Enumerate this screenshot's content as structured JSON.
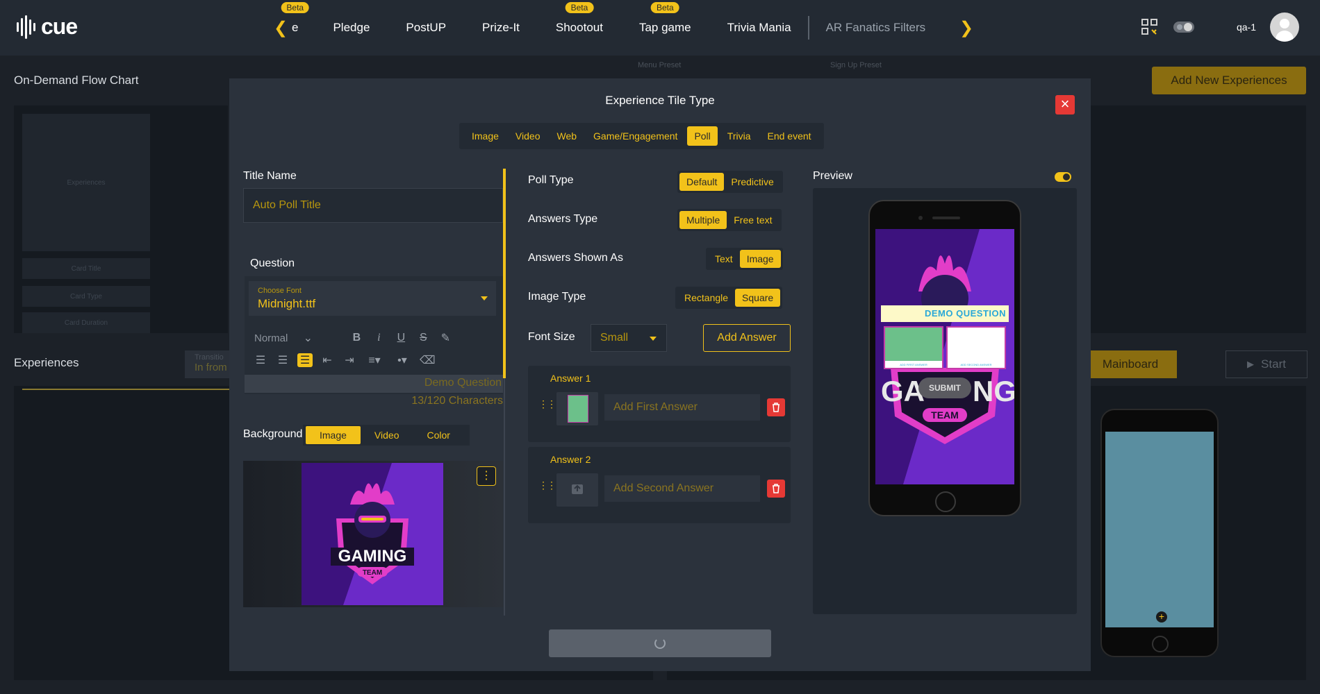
{
  "app": {
    "name": "cue",
    "user": "qa-1"
  },
  "nav": {
    "items": [
      {
        "label": "e",
        "beta": true
      },
      {
        "label": "Pledge",
        "beta": false
      },
      {
        "label": "PostUP",
        "beta": false
      },
      {
        "label": "Prize-It",
        "beta": false
      },
      {
        "label": "Shootout",
        "beta": true
      },
      {
        "label": "Tap game",
        "beta": true
      },
      {
        "label": "Trivia Mania",
        "beta": false
      }
    ],
    "beta_label": "Beta",
    "extra_item": "AR Fanatics Filters"
  },
  "background_page": {
    "title": "On-Demand Flow Chart",
    "add_button": "Add New Experiences",
    "menu_preset_label": "Menu Preset",
    "signup_preset_label": "Sign Up Preset",
    "sidebar_cards": [
      "Experiences",
      "Card Title",
      "Card Type",
      "Card Duration"
    ],
    "experiences_label": "Experiences",
    "transition_label": "Transitio",
    "transition_value": "In from",
    "mainboard_button": "Mainboard",
    "start_button": "Start"
  },
  "modal": {
    "title": "Experience Tile Type",
    "tabs": [
      "Image",
      "Video",
      "Web",
      "Game/Engagement",
      "Poll",
      "Trivia",
      "End event"
    ],
    "active_tab": "Poll",
    "title_name": {
      "label": "Title Name",
      "value": "Auto Poll Title"
    },
    "question": {
      "label": "Question",
      "font_label": "Choose Font",
      "font_value": "Midnight.ttf",
      "style_value": "Normal",
      "text": "Demo Question",
      "char_count": "13/120 Characters"
    },
    "background": {
      "label": "Background",
      "tabs": [
        "Image",
        "Video",
        "Color"
      ],
      "active": "Image",
      "logo_text": "GAMING",
      "logo_subtext": "TEAM"
    },
    "poll_type": {
      "label": "Poll Type",
      "options": [
        "Default",
        "Predictive"
      ],
      "selected": "Default"
    },
    "answers_type": {
      "label": "Answers Type",
      "options": [
        "Multiple",
        "Free text"
      ],
      "selected": "Multiple"
    },
    "answers_shown_as": {
      "label": "Answers Shown As",
      "options": [
        "Text",
        "Image"
      ],
      "selected": "Image"
    },
    "image_type": {
      "label": "Image Type",
      "options": [
        "Rectangle",
        "Square"
      ],
      "selected": "Square"
    },
    "font_size": {
      "label": "Font Size",
      "value": "Small"
    },
    "add_answer_button": "Add Answer",
    "answers": [
      {
        "label": "Answer 1",
        "placeholder": "Add First Answer",
        "thumb_color": "#6cc08a"
      },
      {
        "label": "Answer 2",
        "placeholder": "Add Second Answer",
        "thumb_color": ""
      }
    ],
    "preview": {
      "label": "Preview",
      "question_text": "DEMO QUESTION",
      "answer1_caption": "ADD FIRST ANSWER",
      "answer2_caption": "ADD SECOND ANSWER",
      "submit_label": "SUBMIT",
      "logo_text_left": "GA",
      "logo_text_right": "NG",
      "logo_subtext": "TEAM"
    }
  },
  "colors": {
    "accent": "#f2c21a",
    "danger": "#e53935",
    "modal_bg": "#2b323c",
    "page_bg": "#1c2128"
  }
}
